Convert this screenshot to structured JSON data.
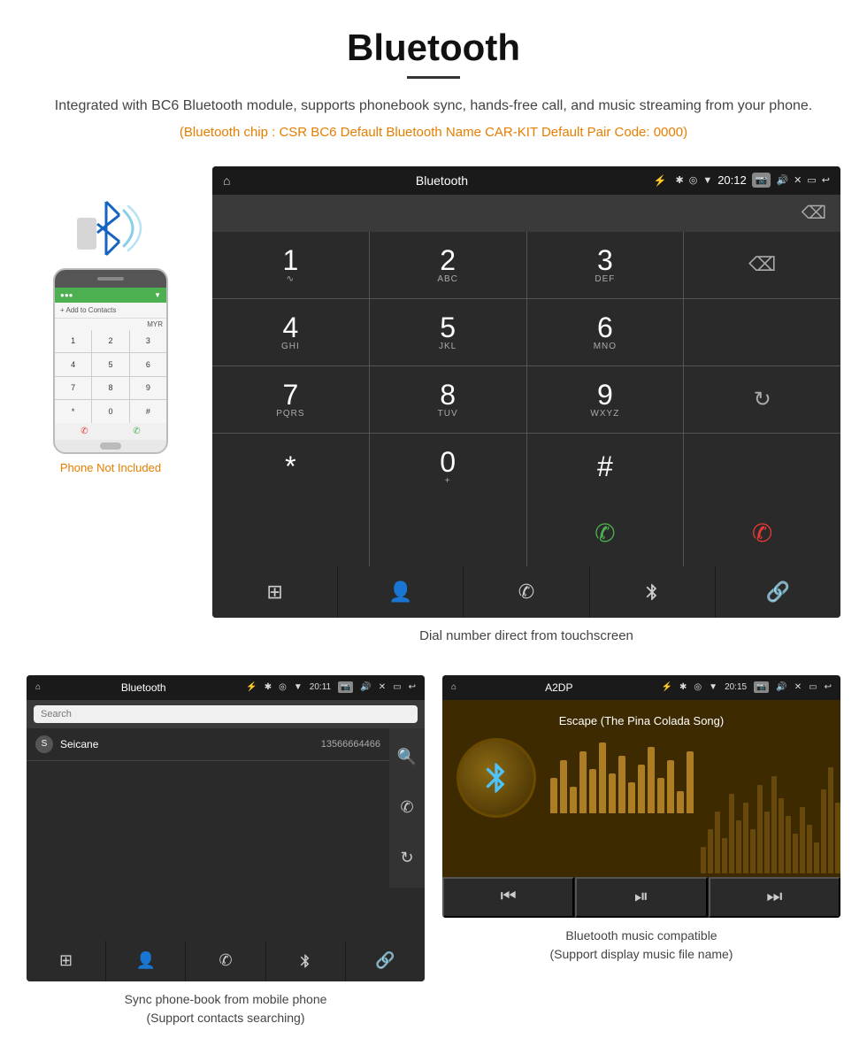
{
  "header": {
    "title": "Bluetooth",
    "description": "Integrated with BC6 Bluetooth module, supports phonebook sync, hands-free call, and music streaming from your phone.",
    "specs": "(Bluetooth chip : CSR BC6    Default Bluetooth Name CAR-KIT    Default Pair Code: 0000)"
  },
  "phone_label": "Phone Not Included",
  "dial_screen": {
    "app_title": "Bluetooth",
    "time": "20:12",
    "keys": [
      {
        "main": "1",
        "sub": ""
      },
      {
        "main": "2",
        "sub": "ABC"
      },
      {
        "main": "3",
        "sub": "DEF"
      },
      {
        "main": "",
        "sub": ""
      },
      {
        "main": "4",
        "sub": "GHI"
      },
      {
        "main": "5",
        "sub": "JKL"
      },
      {
        "main": "6",
        "sub": "MNO"
      },
      {
        "main": "",
        "sub": ""
      },
      {
        "main": "7",
        "sub": "PQRS"
      },
      {
        "main": "8",
        "sub": "TUV"
      },
      {
        "main": "9",
        "sub": "WXYZ"
      },
      {
        "main": "",
        "sub": ""
      },
      {
        "main": "*",
        "sub": ""
      },
      {
        "main": "0",
        "sub": "+"
      },
      {
        "main": "#",
        "sub": ""
      },
      {
        "main": "",
        "sub": ""
      }
    ],
    "caption": "Dial number direct from touchscreen"
  },
  "phonebook_screen": {
    "app_title": "Bluetooth",
    "time": "20:11",
    "search_placeholder": "Search",
    "contact_letter": "S",
    "contact_name": "Seicane",
    "contact_number": "13566664466",
    "caption_line1": "Sync phone-book from mobile phone",
    "caption_line2": "(Support contacts searching)"
  },
  "music_screen": {
    "app_title": "A2DP",
    "time": "20:15",
    "song_title": "Escape (The Pina Colada Song)",
    "caption_line1": "Bluetooth music compatible",
    "caption_line2": "(Support display music file name)"
  },
  "nav_icons": {
    "home": "⌂",
    "grid": "⊞",
    "person": "👤",
    "phone": "✆",
    "bluetooth": "⚡",
    "link": "🔗",
    "back": "↩",
    "prev_track": "⏮",
    "play_pause": "⏯",
    "next_track": "⏭"
  }
}
